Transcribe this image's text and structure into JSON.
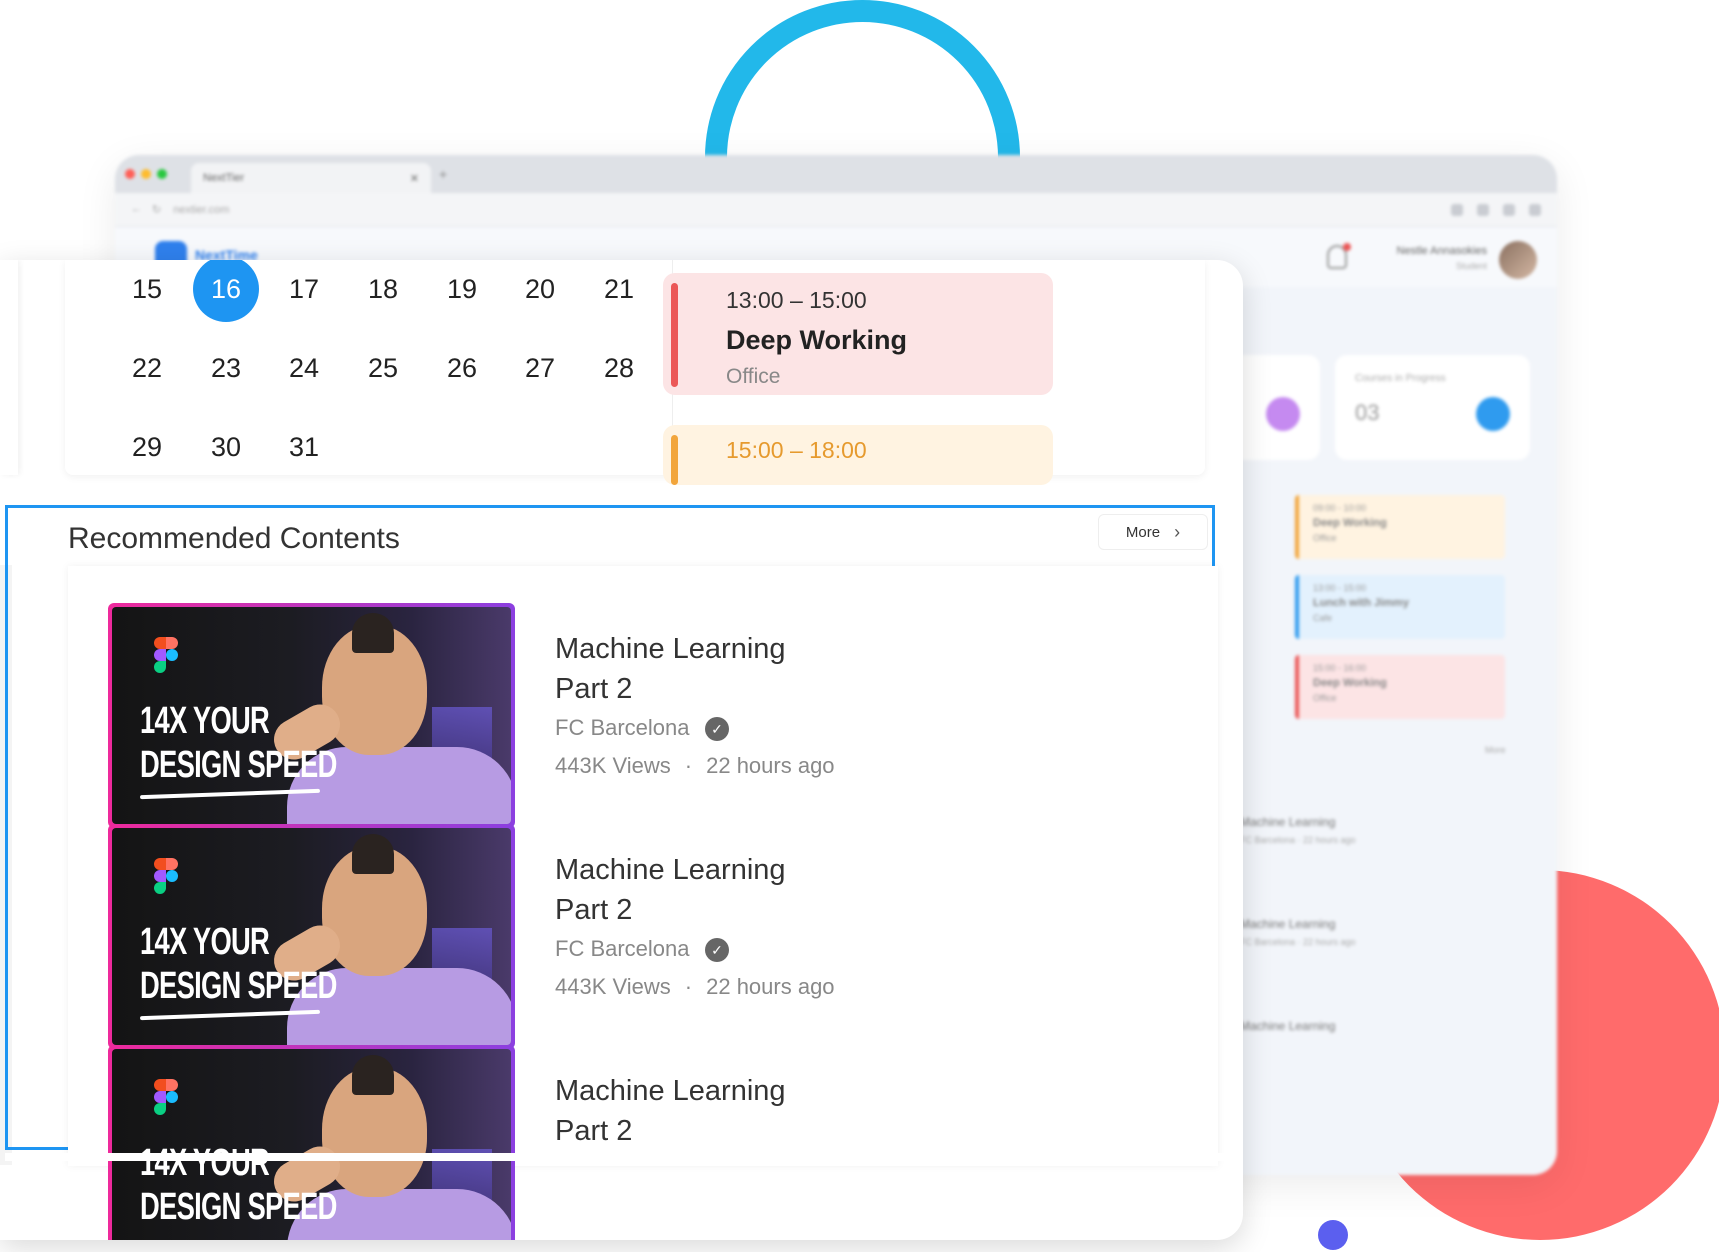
{
  "browser": {
    "tab_title": "NextTier",
    "url": "nextier.com",
    "app_name": "NextTime",
    "user_name": "Nestle Annasokies",
    "user_role": "Student",
    "stats": [
      {
        "label": "",
        "value": "",
        "color": "#C58AF0"
      },
      {
        "label": "Courses in Progress",
        "value": "03",
        "color": "#2F9BEF"
      }
    ],
    "events": [
      {
        "time": "09:00 - 10:00",
        "name": "Deep Working",
        "place": "Office",
        "color": "#F2A53B",
        "bg": "#FFF3E1"
      },
      {
        "time": "13:00 - 15:00",
        "name": "Lunch with Jimmy",
        "place": "Cafe",
        "color": "#2F9BEF",
        "bg": "#E3F1FD"
      },
      {
        "time": "15:00 - 16:00",
        "name": "Deep Working",
        "place": "Office",
        "color": "#EB5757",
        "bg": "#FCE4E5"
      }
    ],
    "more": "More",
    "list": [
      {
        "title": "Machine Learning",
        "meta": "FC Barcelona · 22 hours ago"
      },
      {
        "title": "Machine Learning",
        "meta": "FC Barcelona · 22 hours ago"
      },
      {
        "title": "Machine Learning",
        "meta": ""
      }
    ]
  },
  "calendar": {
    "days": [
      "15",
      "16",
      "17",
      "18",
      "19",
      "20",
      "21",
      "22",
      "23",
      "24",
      "25",
      "26",
      "27",
      "28",
      "29",
      "30",
      "31"
    ],
    "selected_day": "16"
  },
  "schedule": [
    {
      "time": "13:00 – 15:00",
      "title": "Deep Working",
      "place": "Office",
      "color": "#EB5757"
    },
    {
      "time": "15:00 – 18:00",
      "title": "",
      "place": "",
      "color": "#F2A53B"
    }
  ],
  "recommended": {
    "title": "Recommended Contents",
    "more_label": "More",
    "videos": [
      {
        "thumb_text_1": "14X YOUR",
        "thumb_text_2": "DESIGN SPEED",
        "title_1": "Machine Learning",
        "title_2": "Part 2",
        "channel": "FC Barcelona",
        "views": "443K Views",
        "separator": "·",
        "age": "22 hours ago"
      },
      {
        "thumb_text_1": "14X YOUR",
        "thumb_text_2": "DESIGN SPEED",
        "title_1": "Machine Learning",
        "title_2": "Part 2",
        "channel": "FC Barcelona",
        "views": "443K Views",
        "separator": "·",
        "age": "22 hours ago"
      },
      {
        "thumb_text_1": "14X YOUR",
        "thumb_text_2": "DESIGN SPEED",
        "title_1": "Machine Learning",
        "title_2": "Part 2",
        "channel": "",
        "views": "",
        "separator": "",
        "age": ""
      }
    ]
  },
  "colors": {
    "accent": "#1E95F2",
    "ring": "#22B8EA",
    "coral": "#FF6B6B",
    "dot": "#5B5FEF"
  }
}
